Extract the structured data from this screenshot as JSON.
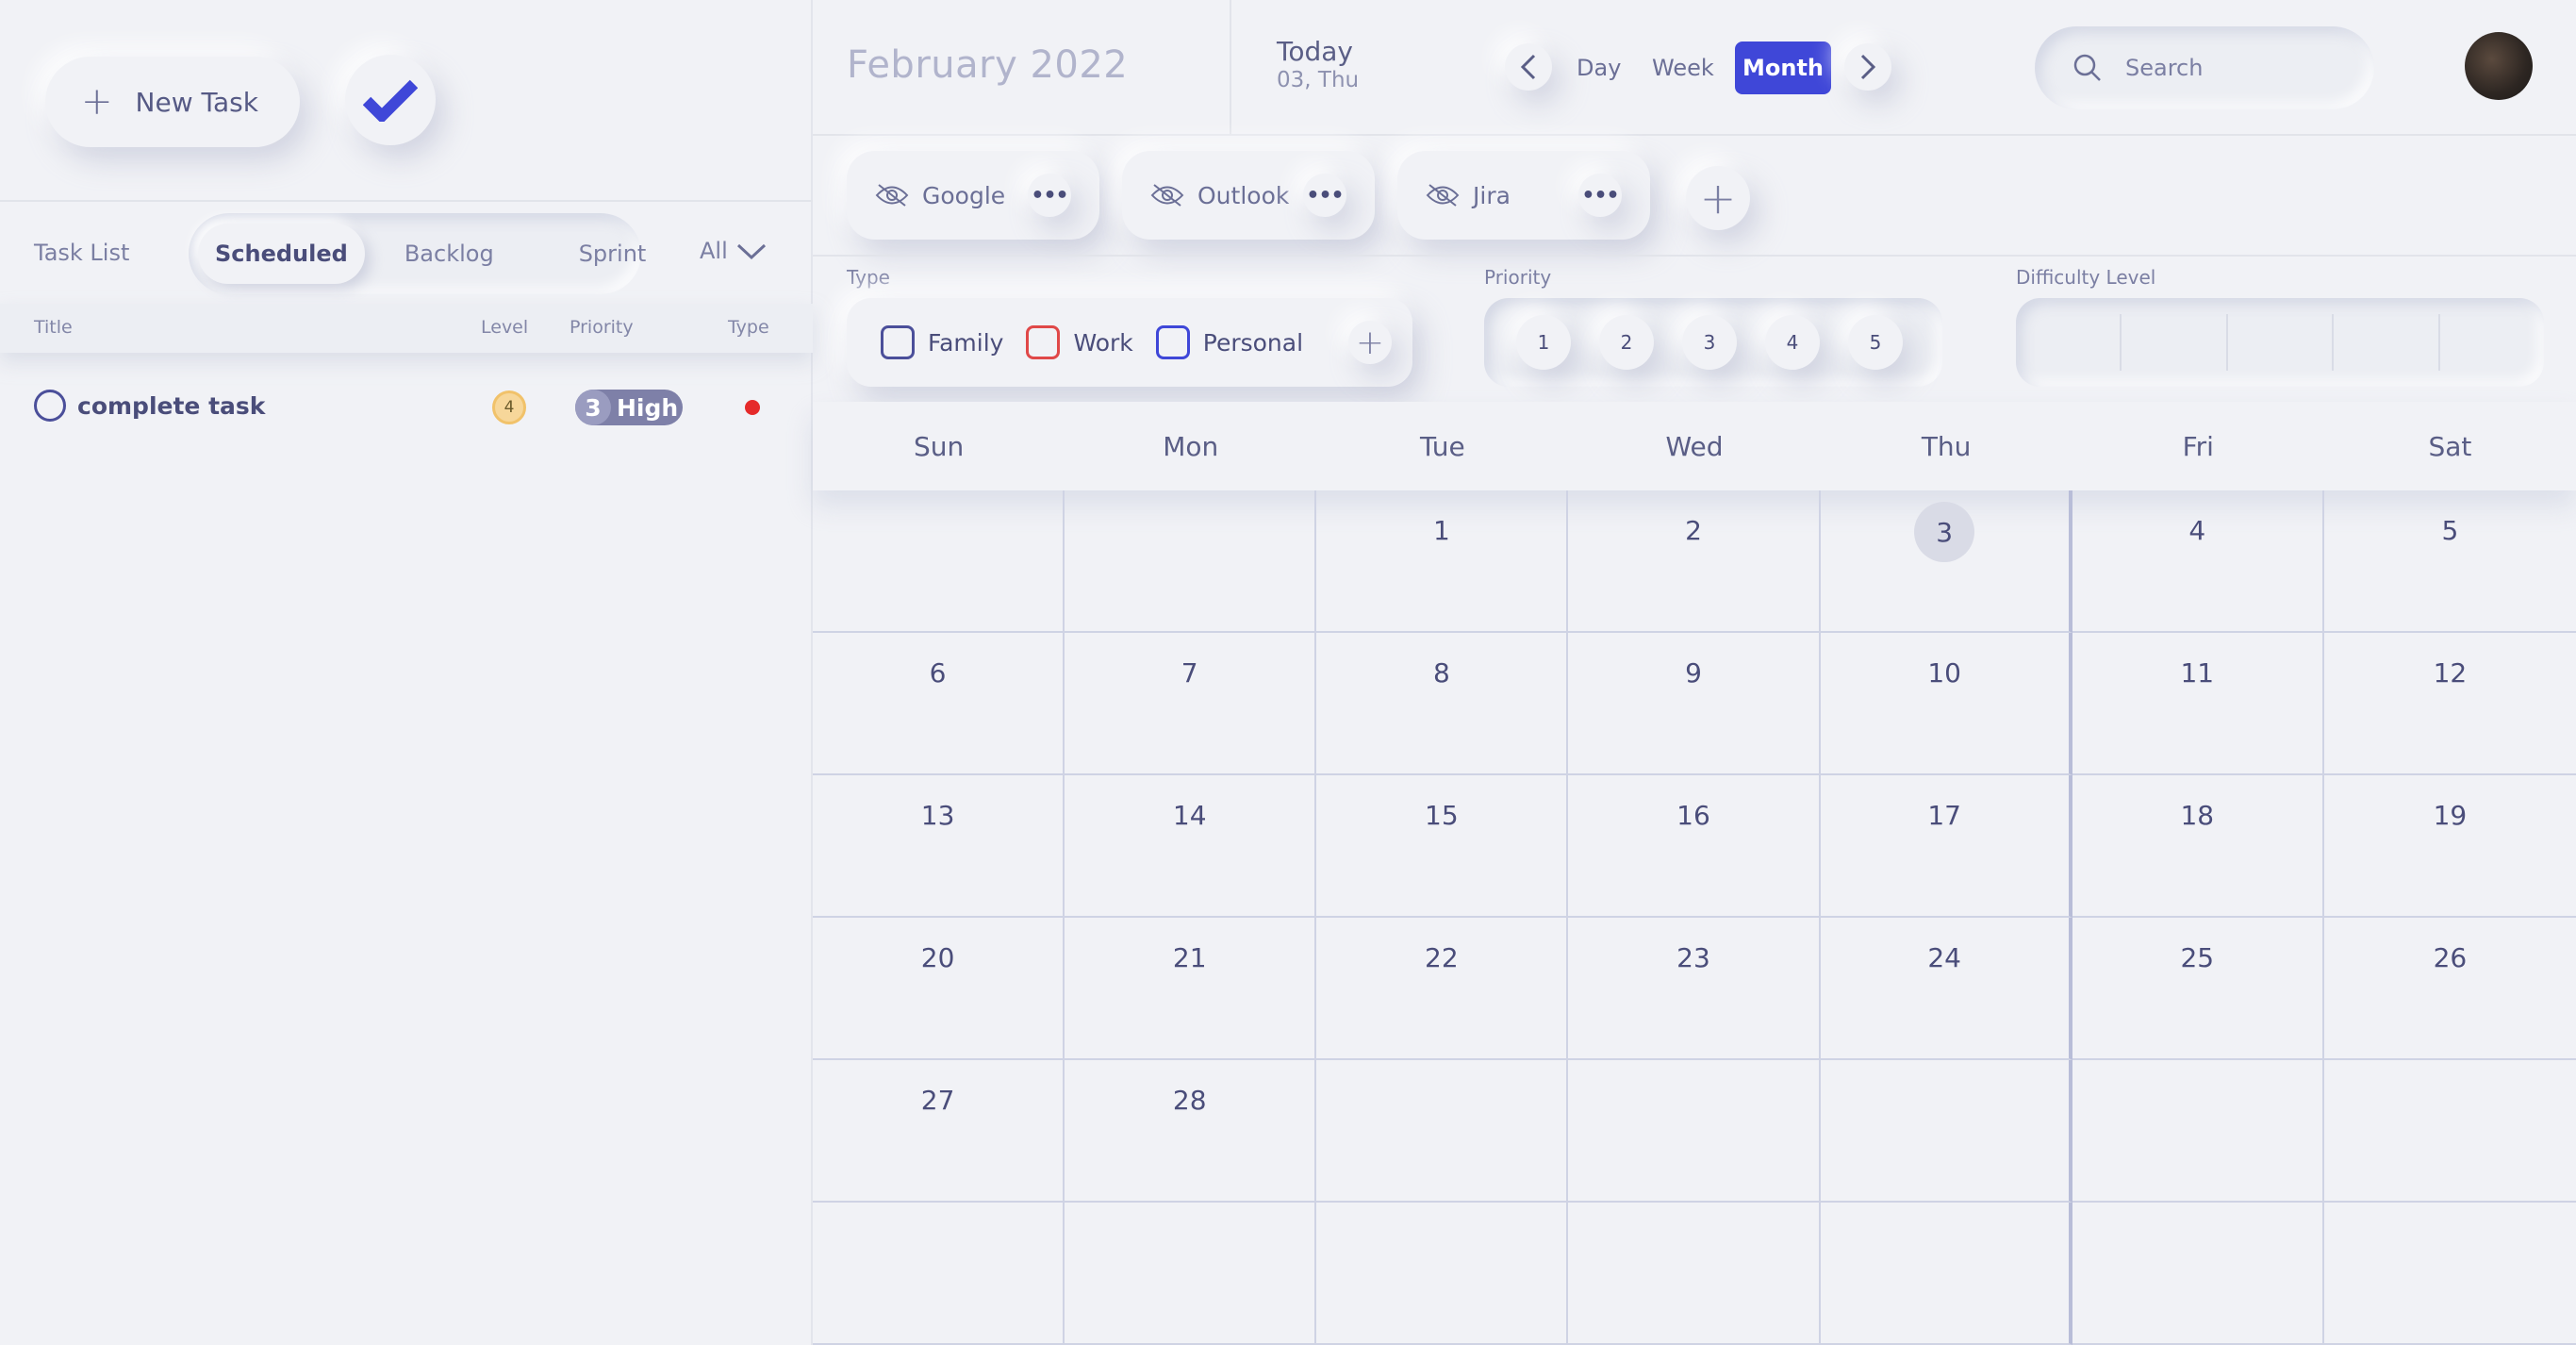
{
  "sidebar": {
    "new_task_label": "New Task",
    "task_list_label": "Task List",
    "tabs": [
      {
        "label": "Scheduled",
        "active": true
      },
      {
        "label": "Backlog",
        "active": false
      },
      {
        "label": "Sprint",
        "active": false
      }
    ],
    "filter_label": "All",
    "columns": {
      "title": "Title",
      "level": "Level",
      "priority": "Priority",
      "type": "Type"
    },
    "tasks": [
      {
        "title": "complete task",
        "level": "4",
        "priority_num": "3",
        "priority_label": "High",
        "type_color": "#e52a2a"
      }
    ]
  },
  "header": {
    "month_title": "February 2022",
    "today_label": "Today",
    "today_date": "03, Thu",
    "views": [
      {
        "label": "Day",
        "active": false
      },
      {
        "label": "Week",
        "active": false
      },
      {
        "label": "Month",
        "active": true
      }
    ],
    "search_placeholder": "Search"
  },
  "calendars": [
    {
      "name": "Google",
      "icon": "eye-off-icon"
    },
    {
      "name": "Outlook",
      "icon": "eye-off-icon"
    },
    {
      "name": "Jira",
      "icon": "eye-off-icon"
    }
  ],
  "filters": {
    "type_label": "Type",
    "types": [
      {
        "label": "Family",
        "color": "#4b4f9a"
      },
      {
        "label": "Work",
        "color": "#e04848"
      },
      {
        "label": "Personal",
        "color": "#3f47d8"
      }
    ],
    "priority_label": "Priority",
    "priorities": [
      "1",
      "2",
      "3",
      "4",
      "5"
    ],
    "difficulty_label": "Difficulty Level"
  },
  "calendar": {
    "weekdays": [
      "Sun",
      "Mon",
      "Tue",
      "Wed",
      "Thu",
      "Fri",
      "Sat"
    ],
    "cells": [
      "",
      "",
      "1",
      "2",
      "3",
      "4",
      "5",
      "6",
      "7",
      "8",
      "9",
      "10",
      "11",
      "12",
      "13",
      "14",
      "15",
      "16",
      "17",
      "18",
      "19",
      "20",
      "21",
      "22",
      "23",
      "24",
      "25",
      "26",
      "27",
      "28",
      "",
      "",
      "",
      "",
      "",
      "",
      "",
      "",
      "",
      "",
      "",
      ""
    ],
    "today": "3"
  },
  "colors": {
    "accent": "#3f47d8",
    "text": "#4a4d7a",
    "background": "#f1f2f6"
  }
}
